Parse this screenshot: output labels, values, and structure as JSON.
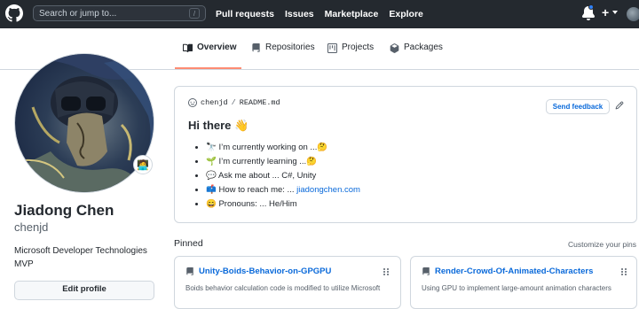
{
  "header": {
    "search_placeholder": "Search or jump to...",
    "search_shortcut": "/",
    "nav": [
      "Pull requests",
      "Issues",
      "Marketplace",
      "Explore"
    ],
    "plus_label": "+",
    "notification_dot_color": "#2f81f7"
  },
  "tabs": [
    {
      "label": "Overview",
      "icon": "book-icon",
      "active": true
    },
    {
      "label": "Repositories",
      "icon": "repo-icon",
      "active": false
    },
    {
      "label": "Projects",
      "icon": "project-icon",
      "active": false
    },
    {
      "label": "Packages",
      "icon": "package-icon",
      "active": false
    }
  ],
  "profile": {
    "name": "Jiadong Chen",
    "login": "chenjd",
    "bio": "Microsoft Developer Technologies MVP",
    "status_emoji": "🧑‍💻",
    "edit_label": "Edit profile"
  },
  "readme": {
    "owner": "chenjd",
    "separator": "/",
    "file": "README.md",
    "feedback_label": "Send feedback",
    "greeting": "Hi there 👋",
    "items": [
      {
        "text": "🔭 I’m currently working on ...🤔"
      },
      {
        "text": "🌱 I’m currently learning ...🤔"
      },
      {
        "text": "💬 Ask me about ... C#, Unity"
      },
      {
        "text_before": "📫 How to reach me: ... ",
        "link": "jiadongchen.com"
      },
      {
        "text": "😄 Pronouns: ... He/Him"
      }
    ]
  },
  "pinned": {
    "heading": "Pinned",
    "customize_label": "Customize your pins",
    "repos": [
      {
        "name": "Unity-Boids-Behavior-on-GPGPU",
        "description": "Boids behavior calculation code is modified to utilize Microsoft"
      },
      {
        "name": "Render-Crowd-Of-Animated-Characters",
        "description": "Using GPU to implement large-amount animation characters"
      }
    ]
  },
  "colors": {
    "accent_link": "#0969da",
    "tab_underline": "#fd8c73",
    "header_bg": "#24292f"
  }
}
